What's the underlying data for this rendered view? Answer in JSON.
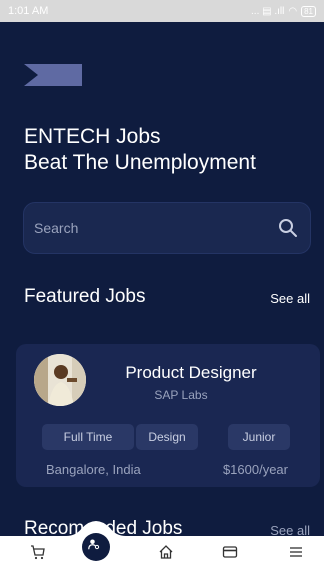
{
  "status_bar": {
    "time": "1:01 AM",
    "signal": "... ▤ .ıll",
    "battery": "81"
  },
  "header": {
    "line1": "ENTECH Jobs",
    "line2": "Beat The Unemployment"
  },
  "search": {
    "placeholder": "Search"
  },
  "featured": {
    "title": "Featured Jobs",
    "see_all": "See all",
    "card": {
      "job_title": "Product Designer",
      "company": "SAP Labs",
      "tags": [
        "Full Time",
        "Design",
        "Junior"
      ],
      "location": "Bangalore, India",
      "salary": "$1600/year"
    }
  },
  "recommended": {
    "title": "Recomended Jobs",
    "see_all": "See all"
  },
  "bottom_nav": [
    "cart-icon",
    "search-jobs-icon",
    "home-icon",
    "card-icon",
    "menu-icon"
  ],
  "colors": {
    "background": "#0f1c3f",
    "card": "#1a2752",
    "tag": "#2a3866",
    "logo": "#5f6aa3"
  }
}
